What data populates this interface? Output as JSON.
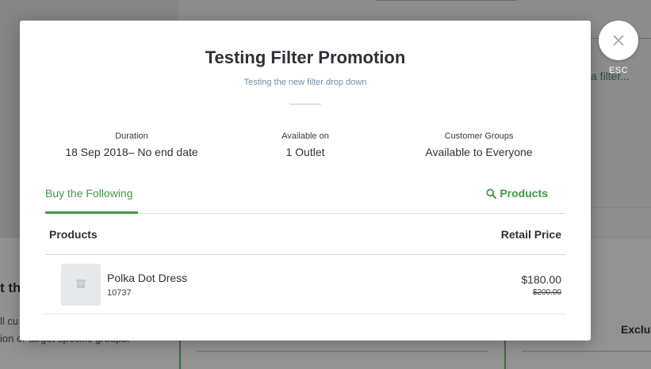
{
  "background": {
    "filter_link": "a filter...",
    "heading": "t thi",
    "line1": "ll cu",
    "line2": "ion or target specific groups.",
    "exclusions_label": "Exclus"
  },
  "close": {
    "esc_label": "ESC",
    "icon": "close-icon"
  },
  "modal": {
    "title": "Testing Filter Promotion",
    "subtitle": "Testing the new filter drop down",
    "summary": {
      "duration_label": "Duration",
      "duration_value": "18 Sep 2018– No end date",
      "available_label": "Available on",
      "available_value": "1 Outlet",
      "groups_label": "Customer Groups",
      "groups_value": "Available to Everyone"
    },
    "tabs": {
      "buy_label": "Buy the Following",
      "products_label": "Products",
      "products_icon": "search-icon"
    },
    "table": {
      "col_products": "Products",
      "col_price": "Retail Price",
      "rows": [
        {
          "name": "Polka Dot Dress",
          "sku": "10737",
          "price": "$180.00",
          "original_price": "$200.00",
          "image_icon": "image-placeholder-icon"
        }
      ]
    }
  },
  "colors": {
    "accent": "#3e9b45",
    "subtitle": "#6e8ea6",
    "text": "#2c3237"
  }
}
